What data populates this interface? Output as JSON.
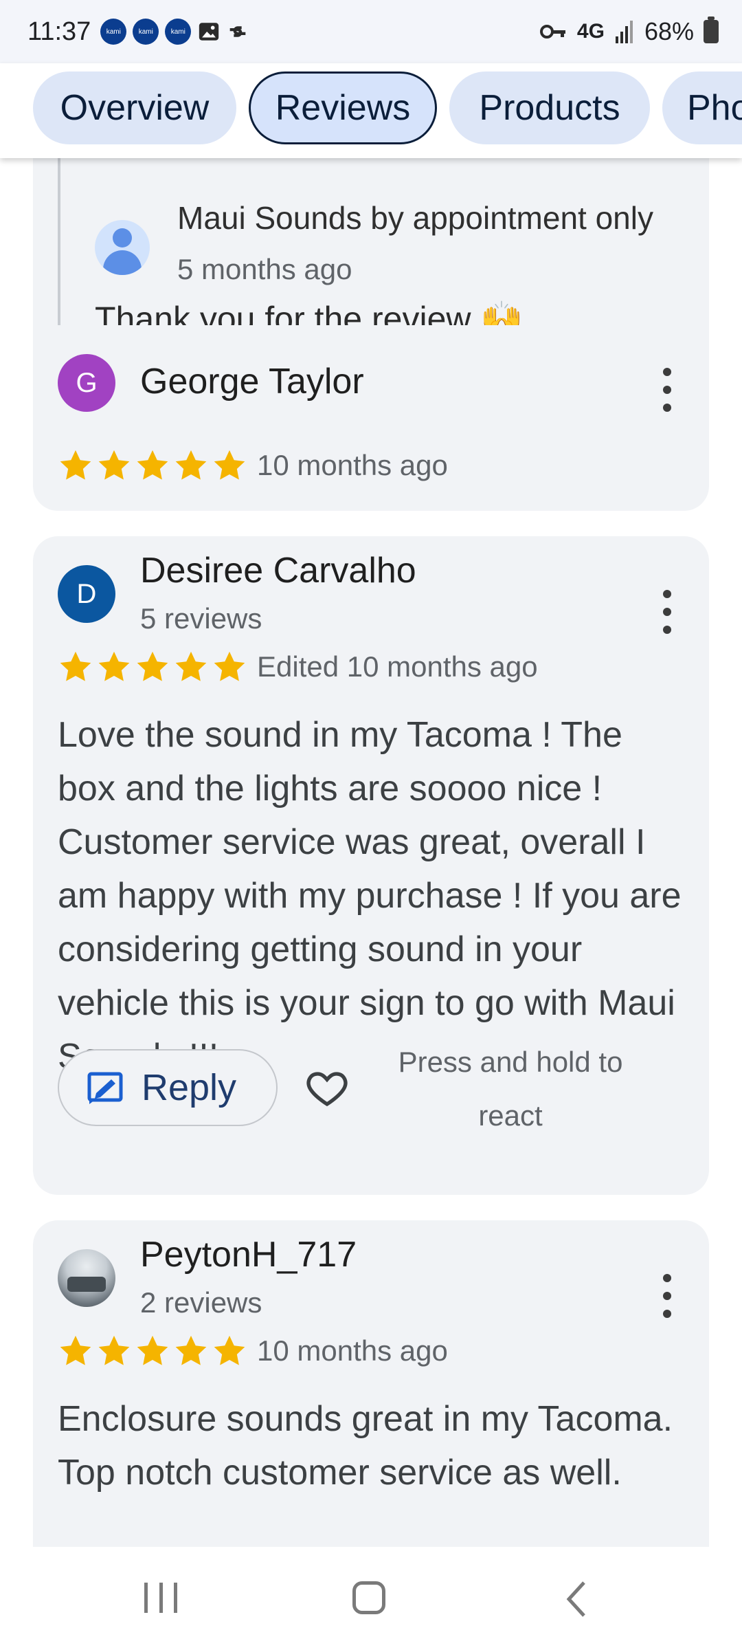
{
  "status_bar": {
    "time": "11:37",
    "notif_icons": [
      "kami",
      "kami",
      "kami"
    ],
    "network": "4G",
    "battery": "68%"
  },
  "tabs": [
    {
      "label": "Overview",
      "active": false
    },
    {
      "label": "Reviews",
      "active": true
    },
    {
      "label": "Products",
      "active": false
    },
    {
      "label": "Photos",
      "active": false
    }
  ],
  "owner_response": {
    "name": "Maui Sounds by appointment only",
    "time": "5 months ago",
    "text": "Thank you for the review 🙌"
  },
  "reviews": [
    {
      "initial": "G",
      "avatar_color": "#a142c2",
      "name": "George Taylor",
      "meta": "",
      "rating": 5,
      "time": "10 months ago",
      "text": ""
    },
    {
      "initial": "D",
      "avatar_color": "#0b57a0",
      "name": "Desiree Carvalho",
      "meta": "5 reviews",
      "rating": 5,
      "time": "Edited 10 months ago",
      "text": "Love the sound in my Tacoma ! The box and the lights are soooo nice ! Customer service was great, overall I am happy with my purchase ! If you are considering getting sound in your vehicle this is your sign to go with Maui Sounds !!!",
      "reply_label": "Reply",
      "react_hint": "Press and hold to react"
    },
    {
      "initial": "",
      "avatar_color": "#8a9097",
      "name": "PeytonH_717",
      "meta": "2 reviews",
      "rating": 5,
      "time": "10 months ago",
      "text": "Enclosure sounds great in my Tacoma. Top notch customer service as well."
    }
  ],
  "colors": {
    "star": "#f5b400",
    "tab_bg": "#dde6f7",
    "card_bg": "#f1f3f6"
  }
}
